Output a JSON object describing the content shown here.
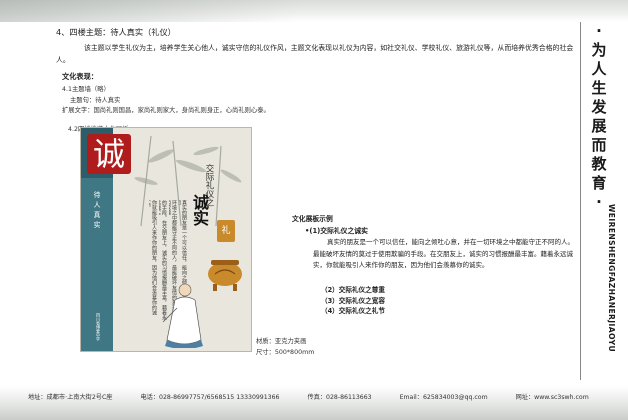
{
  "header": {
    "heading": "4、四楼主题：待人真实（礼仪）",
    "intro": "该主题以学生礼仪为主，培养学生关心他人，诚实守信的礼仪作风，主题文化表现以礼仪为内容，如社交礼仪、学校礼仪、旅游礼仪等，从而培养优秀合格的社会人。"
  },
  "culture": {
    "label": "文化表现：",
    "wall": "4.1主题墙（略）",
    "theme_line": "主题句：待人真实",
    "ext_line": "扩展文字：国尚礼则国昌，家尚礼则家大，身尚礼则身正，心尚礼则心泰。",
    "corridor": "4.2四楼楼道文化展板"
  },
  "panel": {
    "big_char": "诚",
    "stripe_chars": [
      "待",
      "人",
      "真",
      "实"
    ],
    "school_name": "四川省博爱中学",
    "title_small": "交际礼仪之",
    "title_big": "诚实",
    "seal_text": "礼",
    "text_cols": [
      "真实的朋友是一个可以信任，能向之倾吐心意，并在一切",
      "环境之中都能守正不阿的人，最能破坏友情的莫过于使用欺骗",
      "的手段。在交朋友上，诚实的习惯报酬最丰富，藉着永远诚实",
      "你就能吸引人来作你的朋友，因为他们会羡慕你的诚实。"
    ]
  },
  "material": {
    "material_line": "材质：亚克力夹画",
    "size_line": "尺寸：500*800mm"
  },
  "example": {
    "label": "文化展板示例",
    "title": "•(1)交际礼仪之诚实",
    "para": "真实的朋友是一个可以信任，能向之倾吐心意，并在一切环境之中都能守正不阿的人。最能破坏友情的莫过于使用欺骗的手段。在交朋友上，诚实的习惯报酬最丰富。藉着永远诚实，你就能吸引人来作你的朋友，因为他们会羡慕你的诚实。",
    "list": [
      "（2）交际礼仪之尊重",
      "（3）交际礼仪之宽容",
      "（4）交际礼仪之礼节"
    ]
  },
  "sidebar": {
    "title_chars": [
      "·",
      "为",
      "人",
      "生",
      "发",
      "展",
      "而",
      "教",
      "育",
      "·"
    ],
    "pinyin": "WEIRENSHENGFAZHANERJIAOYU"
  },
  "footer": {
    "address": "地址：成都市·上南大街2号C座",
    "phone": "电话：028-86997757/6568515  13330991366",
    "fax": "传真：028-86113663",
    "email": "Email：625834003@qq.com",
    "web": "网址：www.sc3swh.com"
  },
  "colors": {
    "accent_red": "#b01c1c",
    "stripe_teal": "#3f7884",
    "seal_gold": "#c88a2b"
  }
}
